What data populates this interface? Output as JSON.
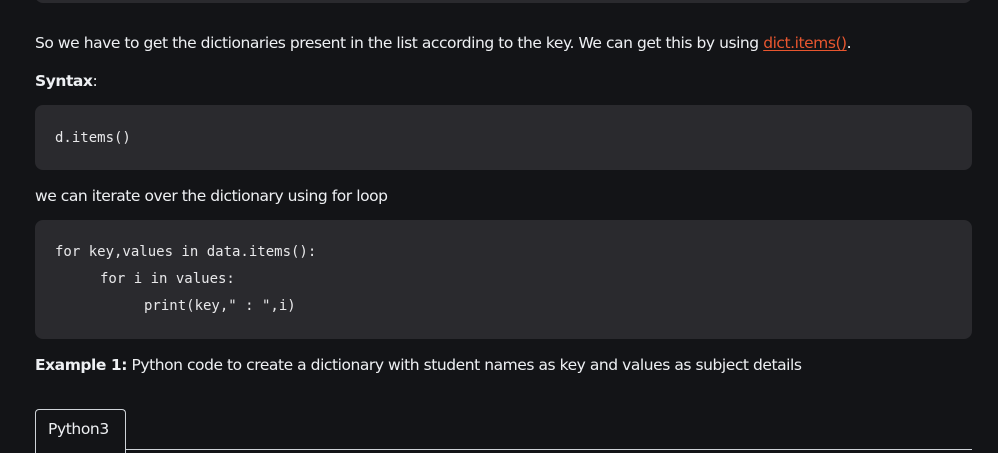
{
  "article": {
    "intro_text": "So we have to get the dictionaries present in the list according to the key. We can get this by using ",
    "intro_link": "dict.items()",
    "intro_end": ".",
    "syntax_label": "Syntax",
    "syntax_colon": ":",
    "syntax_code": "d.items()",
    "iterate_text": "we can iterate over the dictionary using for loop",
    "code_lines": [
      "for key,values in data.items():",
      "for i in values:",
      "print(key,\" : \",i)"
    ],
    "example_label": "Example 1:",
    "example_text": " Python code to create a dictionary with student names as key and values as subject details",
    "tab_label": "Python3"
  },
  "colors": {
    "background": "#131417",
    "code_background": "#2a2a2e",
    "link": "#e8562f",
    "text": "#eef0f3"
  }
}
